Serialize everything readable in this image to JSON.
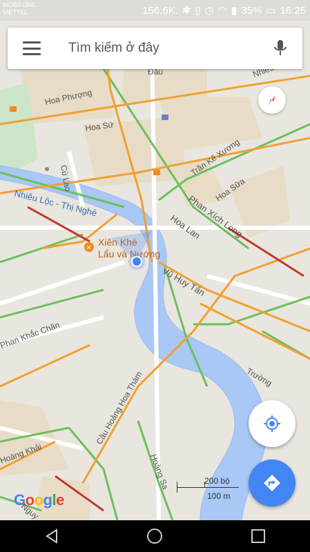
{
  "status": {
    "carrier1": "MOBIFONE",
    "carrier2": "VIETTEL",
    "speed": "156,6K.",
    "battery": "35%",
    "time": "16:25"
  },
  "search": {
    "placeholder": "Tìm kiếm ở đây"
  },
  "map": {
    "streets": [
      "Hoa Phượng",
      "Hoa Sứ",
      "Cù Lao",
      "Trần Kế Xương",
      "Hoa Sữa",
      "Nhiêu Lộc - Thị Nghè",
      "Phan Xích Long",
      "Hoa Lan",
      "Vũ Huy Tấn",
      "Trường",
      "Cầu Hoàng Hoa Thám",
      "Hoàng Sa",
      "Phan Khắc Chân",
      "Hoàng Khải",
      "Nhiêu",
      "Đâu",
      "Nguy"
    ],
    "poi": {
      "name_line1": "Xiên Khè",
      "name_line2": "Lẩu và Nướng"
    }
  },
  "scale": {
    "top_label": "200 bộ",
    "bottom_label": "100 m"
  },
  "logo": {
    "text": "Google"
  },
  "colors": {
    "water": "#a9c8f5",
    "road_major": "#f5a623",
    "road_green": "#5cb85c",
    "accent_blue": "#4285f4"
  }
}
